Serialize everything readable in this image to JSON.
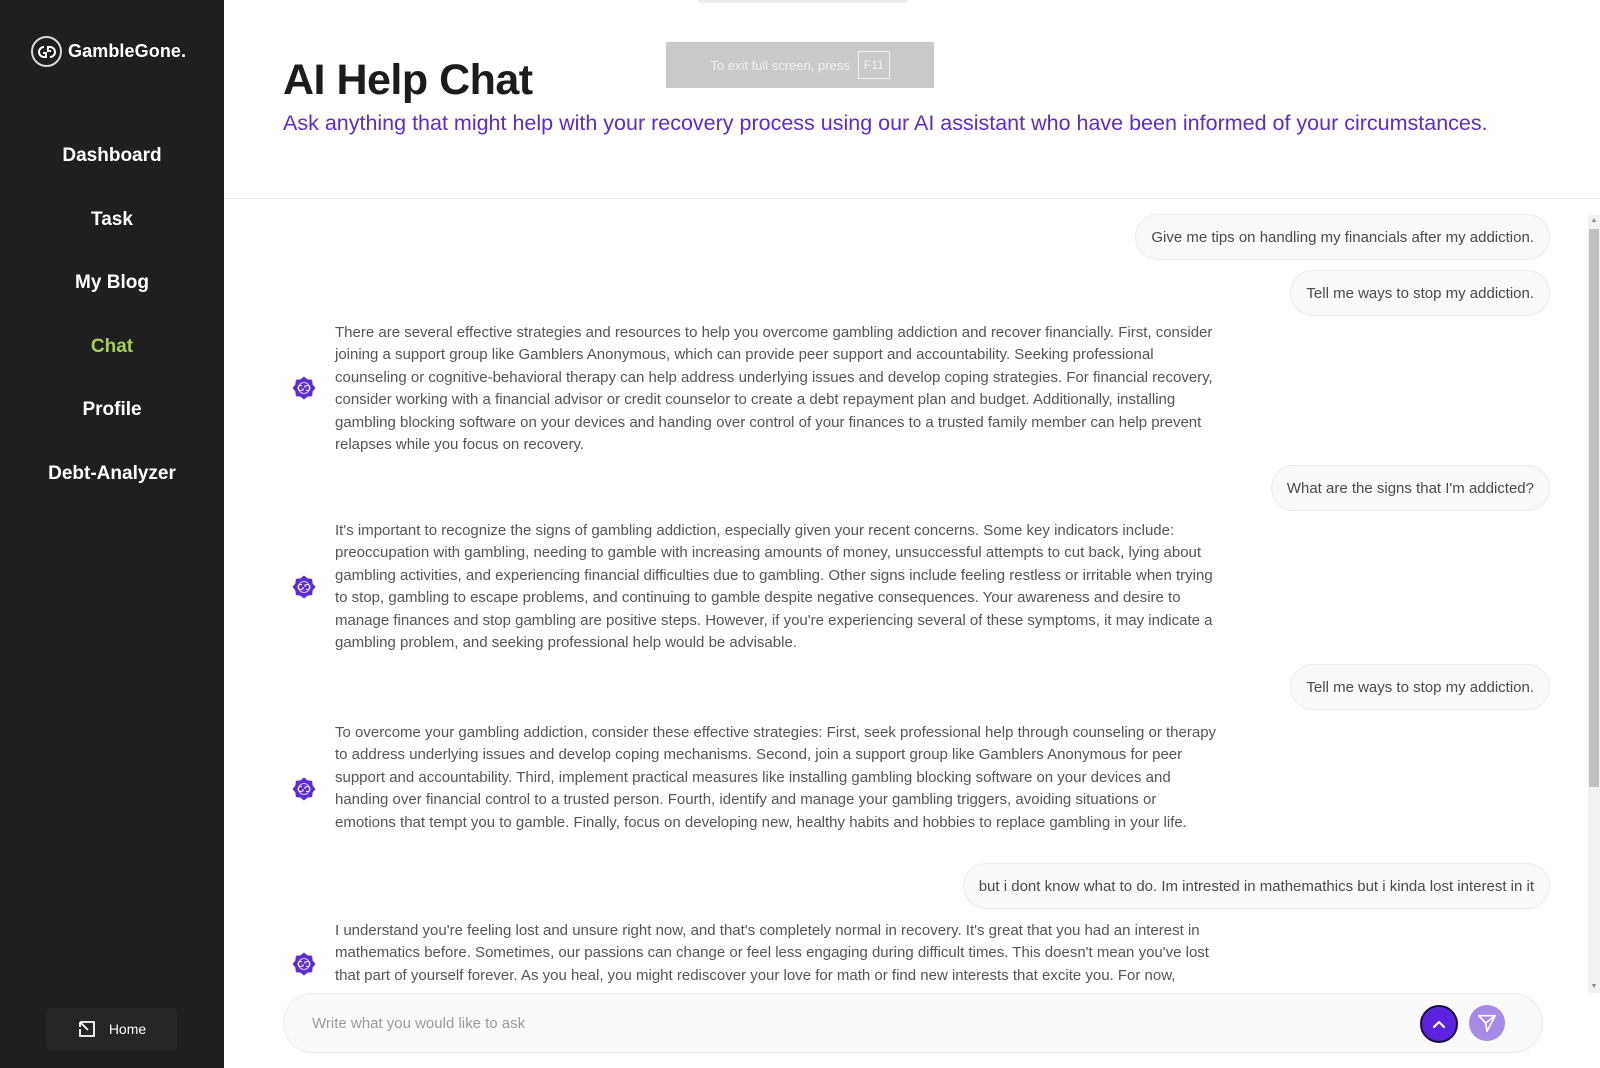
{
  "app": {
    "brand_name": "GambleGone.",
    "accent_color": "#5b2bd3",
    "active_nav_color": "#a6d04d"
  },
  "sidebar": {
    "items": [
      {
        "label": "Dashboard",
        "active": false
      },
      {
        "label": "Task",
        "active": false
      },
      {
        "label": "My Blog",
        "active": false
      },
      {
        "label": "Chat",
        "active": true
      },
      {
        "label": "Profile",
        "active": false
      },
      {
        "label": "Debt-Analyzer",
        "active": false
      }
    ],
    "home_label": "Home"
  },
  "fullscreen_notice": {
    "text": "To exit full screen, press",
    "key": "F11"
  },
  "header": {
    "title": "AI Help Chat",
    "subtitle": "Ask anything that might help with your recovery process using our AI assistant who have been informed of your circumstances."
  },
  "chat": {
    "messages": [
      {
        "role": "user",
        "text": "Give me tips on handling my financials after my addiction."
      },
      {
        "role": "user",
        "text": "Tell me ways to stop my addiction."
      },
      {
        "role": "assistant",
        "text": "There are several effective strategies and resources to help you overcome gambling addiction and recover financially. First, consider joining a support group like Gamblers Anonymous, which can provide peer support and accountability. Seeking professional counseling or cognitive-behavioral therapy can help address underlying issues and develop coping strategies. For financial recovery, consider working with a financial advisor or credit counselor to create a debt repayment plan and budget. Additionally, installing gambling blocking software on your devices and handing over control of your finances to a trusted family member can help prevent relapses while you focus on recovery."
      },
      {
        "role": "user",
        "text": "What are the signs that I'm addicted?"
      },
      {
        "role": "assistant",
        "text": "It's important to recognize the signs of gambling addiction, especially given your recent concerns. Some key indicators include: preoccupation with gambling, needing to gamble with increasing amounts of money, unsuccessful attempts to cut back, lying about gambling activities, and experiencing financial difficulties due to gambling. Other signs include feeling restless or irritable when trying to stop, gambling to escape problems, and continuing to gamble despite negative consequences. Your awareness and desire to manage finances and stop gambling are positive steps. However, if you're experiencing several of these symptoms, it may indicate a gambling problem, and seeking professional help would be advisable."
      },
      {
        "role": "user",
        "text": "Tell me ways to stop my addiction."
      },
      {
        "role": "assistant",
        "text": "To overcome your gambling addiction, consider these effective strategies: First, seek professional help through counseling or therapy to address underlying issues and develop coping mechanisms. Second, join a support group like Gamblers Anonymous for peer support and accountability. Third, implement practical measures like installing gambling blocking software on your devices and handing over financial control to a trusted person. Fourth, identify and manage your gambling triggers, avoiding situations or emotions that tempt you to gamble. Finally, focus on developing new, healthy habits and hobbies to replace gambling in your life."
      },
      {
        "role": "user",
        "text": "but i dont know what to do. Im intrested in mathemathics but i kinda lost interest in it"
      },
      {
        "role": "assistant",
        "text": "I understand you're feeling lost and unsure right now, and that's completely normal in recovery. It's great that you had an interest in mathematics before. Sometimes, our passions can change or feel less engaging during difficult times. This doesn't mean you've lost that part of yourself forever. As you heal, you might rediscover your love for math or find new interests that excite you. For now,"
      }
    ]
  },
  "composer": {
    "placeholder": "Write what you would like to ask",
    "value": ""
  },
  "icons": {
    "bot_avatar": "gear-badge-icon",
    "scroll_up": "chevron-up-icon",
    "send": "paper-plane-icon",
    "home": "arrow-up-left-box-icon"
  }
}
